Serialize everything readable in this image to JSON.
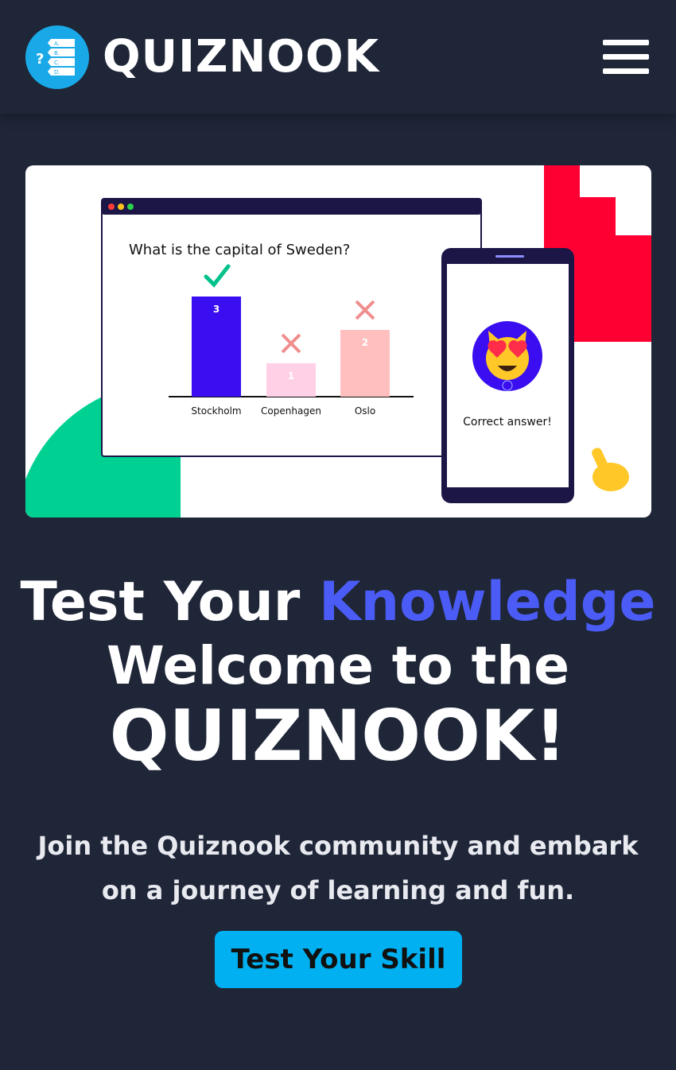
{
  "header": {
    "brand": "QUIZNOOK",
    "logo_icon": "quiz-list-icon",
    "logo_letters": [
      "A.",
      "B.",
      "C.",
      "D."
    ],
    "logo_question": "?",
    "menu_icon": "hamburger-menu-icon"
  },
  "hero_illustration": {
    "question": "What is the capital of Sweden?",
    "phone_message": "Correct answer!",
    "chart_data": {
      "type": "bar",
      "categories": [
        "Stockholm",
        "Copenhagen",
        "Oslo"
      ],
      "values": [
        3,
        1,
        2
      ],
      "marks": [
        "correct",
        "wrong",
        "wrong"
      ],
      "colors": [
        "#3a0ef0",
        "#ffd0e6",
        "#ffbfbf"
      ]
    }
  },
  "headline": {
    "part1": "Test Your ",
    "accent": "Knowledge",
    "line2": "Welcome to the",
    "line3": "QUIZNOOK!"
  },
  "subtitle": "Join the Quiznook community and embark on a journey of learning and fun.",
  "cta_label": "Test Your Skill",
  "colors": {
    "background": "#1f2638",
    "accent": "#4a5cf5",
    "cta": "#00b0f0",
    "logo": "#1aa9e8"
  }
}
